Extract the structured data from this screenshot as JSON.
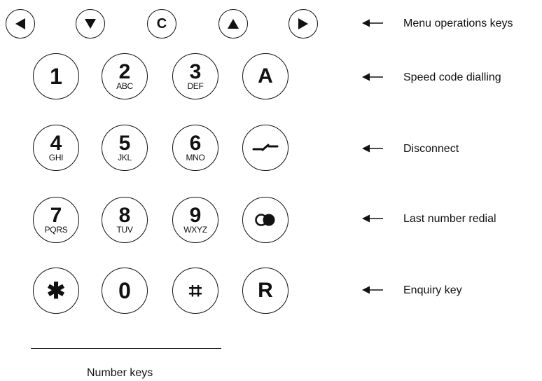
{
  "menu_keys": [
    {
      "id": "left",
      "icon": "triangle-left-icon"
    },
    {
      "id": "down",
      "icon": "triangle-down-icon"
    },
    {
      "id": "clear",
      "label": "C"
    },
    {
      "id": "up",
      "icon": "triangle-up-icon"
    },
    {
      "id": "right",
      "icon": "triangle-right-icon"
    }
  ],
  "keypad": {
    "row1": [
      {
        "digit": "1",
        "letters": ""
      },
      {
        "digit": "2",
        "letters": "ABC"
      },
      {
        "digit": "3",
        "letters": "DEF"
      },
      {
        "label": "A"
      }
    ],
    "row2": [
      {
        "digit": "4",
        "letters": "GHI"
      },
      {
        "digit": "5",
        "letters": "JKL"
      },
      {
        "digit": "6",
        "letters": "MNO"
      },
      {
        "icon": "disconnect-icon"
      }
    ],
    "row3": [
      {
        "digit": "7",
        "letters": "PQRS"
      },
      {
        "digit": "8",
        "letters": "TUV"
      },
      {
        "digit": "9",
        "letters": "WXYZ"
      },
      {
        "icon": "redial-icon"
      }
    ],
    "row4": [
      {
        "label": "✱",
        "icon": "asterisk-icon"
      },
      {
        "label": "0"
      },
      {
        "label": "⌗",
        "icon": "hash-icon"
      },
      {
        "label": "R"
      }
    ]
  },
  "labels": {
    "menu": "Menu operations keys",
    "speed": "Speed code dialling",
    "disconnect": "Disconnect",
    "redial": "Last number redial",
    "enquiry": "Enquiry key"
  },
  "caption": "Number keys"
}
